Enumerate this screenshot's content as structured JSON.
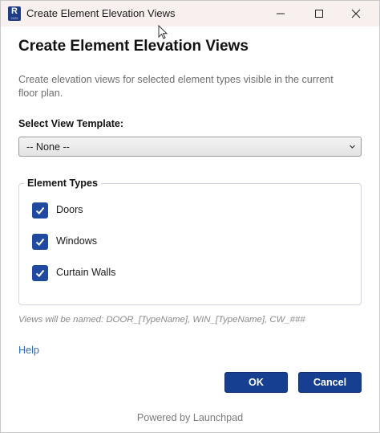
{
  "window": {
    "title": "Create Element Elevation Views",
    "app_icon_letter": "R",
    "app_icon_sub": "2025"
  },
  "dialog": {
    "heading": "Create Element Elevation Views",
    "description": "Create elevation views for selected element types visible in the current floor plan.",
    "template_label": "Select View Template:",
    "template_selected": "-- None --",
    "group_title": "Element Types",
    "element_types": [
      {
        "label": "Doors",
        "checked": true
      },
      {
        "label": "Windows",
        "checked": true
      },
      {
        "label": "Curtain Walls",
        "checked": true
      }
    ],
    "naming_note": "Views will be named: DOOR_[TypeName], WIN_[TypeName], CW_###",
    "help_link": "Help",
    "ok_label": "OK",
    "cancel_label": "Cancel",
    "footer": "Powered by Launchpad"
  },
  "colors": {
    "accent": "#163f91",
    "checkbox": "#1f4aa0",
    "link": "#2b6cb0",
    "titlebar": "#f7f0ee"
  }
}
